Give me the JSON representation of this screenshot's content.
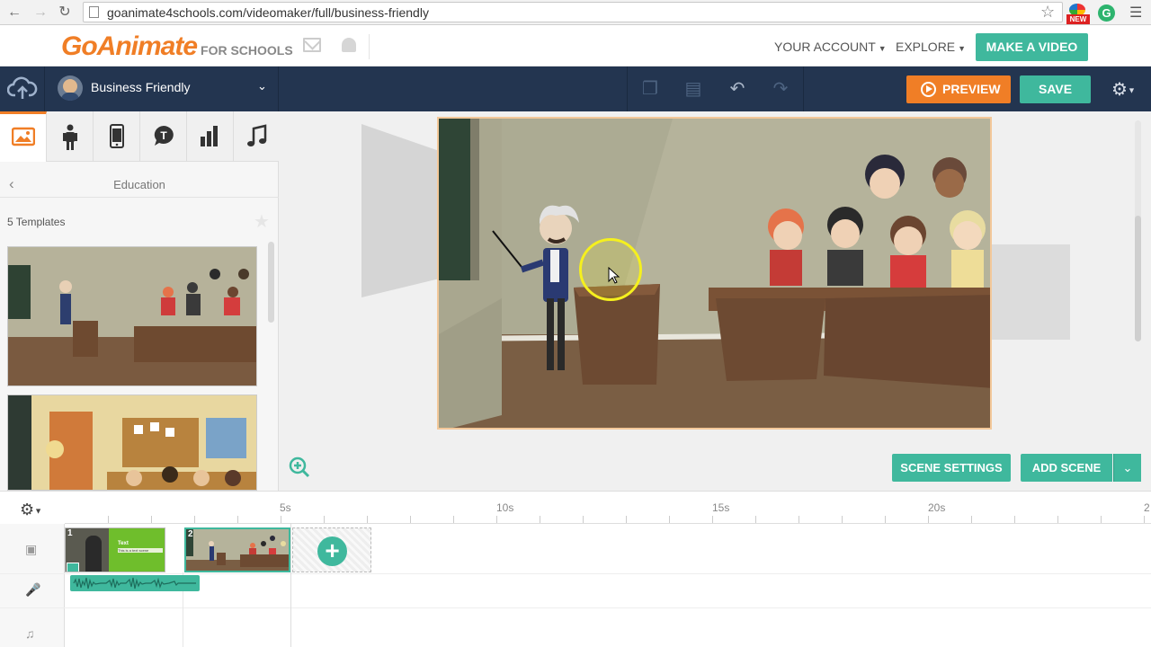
{
  "browser": {
    "url": "goanimate4schools.com/videomaker/full/business-friendly",
    "ext_badge": "NEW",
    "ext_letter": "G"
  },
  "header": {
    "logo_main": "GoAnimate",
    "logo_sub": "FOR SCHOOLS",
    "your_account": "YOUR ACCOUNT",
    "explore": "EXPLORE",
    "make_video": "MAKE A VIDEO"
  },
  "toolbar": {
    "theme_name": "Business Friendly",
    "preview": "PREVIEW",
    "save": "SAVE"
  },
  "library": {
    "tabs": [
      "background",
      "character",
      "prop",
      "text-bubble",
      "chart",
      "music"
    ],
    "back_title": "Education",
    "template_count": "5 Templates"
  },
  "stage": {
    "scene_settings": "SCENE SETTINGS",
    "add_scene": "ADD SCENE"
  },
  "timeline": {
    "ticks": [
      "5s",
      "10s",
      "15s",
      "20s",
      "2"
    ],
    "scenes": [
      {
        "num": "1",
        "title": "Text",
        "subtitle": "This is a text scene"
      },
      {
        "num": "2"
      }
    ]
  },
  "colors": {
    "accent_teal": "#3fb89d",
    "accent_orange": "#f07e26",
    "toolbar_navy": "#233550"
  }
}
